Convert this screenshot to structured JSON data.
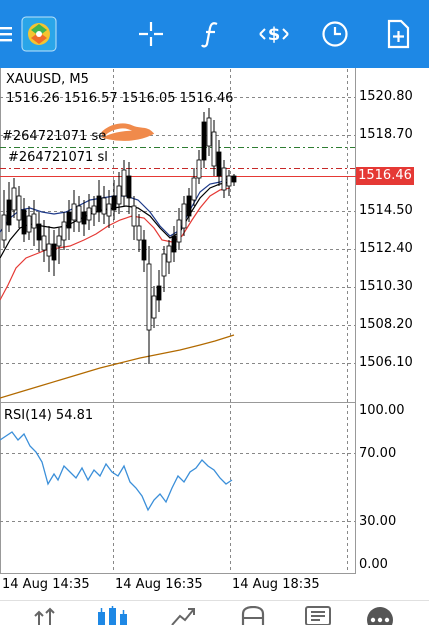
{
  "app": {
    "menu_icon": "hamburger-menu-icon",
    "logo_icon": "metatrader-logo-icon"
  },
  "toolbar": {
    "buttons": [
      {
        "name": "crosshair",
        "icon": "crosshair-icon"
      },
      {
        "name": "indicators",
        "icon": "function-f-icon"
      },
      {
        "name": "symbols",
        "icon": "dollar-arrows-icon"
      },
      {
        "name": "timeframe",
        "icon": "clock-icon"
      },
      {
        "name": "new-order",
        "icon": "document-plus-icon"
      }
    ]
  },
  "chart": {
    "symbol_label": "XAUUSD, M5",
    "ohlc_label": "1516.26 1516.57 1516.05 1516.46",
    "order_line_1": "#264721071 se",
    "order_line_2": "#264721071 sl",
    "price_axis": [
      "1520.80",
      "1518.70",
      "1516.46",
      "1514.50",
      "1512.40",
      "1510.30",
      "1508.20",
      "1506.10"
    ],
    "current_price": "1516.46",
    "rsi_label": "RSI(14) 54.81",
    "rsi_axis": [
      "100.00",
      "70.00",
      "30.00",
      "0.00"
    ],
    "time_axis": [
      "14 Aug 14:35",
      "14 Aug 16:35",
      "14 Aug 18:35"
    ]
  },
  "colors": {
    "topbar": "#1e88e5",
    "bullish_candle": "#ffffff",
    "bearish_candle": "#000000",
    "ma_red": "#e53935",
    "ma_blue": "#1e3a8a",
    "ma_black": "#000000",
    "ma_orange": "#b26a00",
    "rsi_line": "#3b8fd9",
    "current_price_bg": "#e53935",
    "order_line_green": "#2e7d32",
    "annotation_scribble": "#f08a4b"
  },
  "bottom_nav": {
    "items": [
      {
        "name": "quotes",
        "icon": "arrows-up-down-icon"
      },
      {
        "name": "chart",
        "icon": "candlestick-icon",
        "active": true
      },
      {
        "name": "trade",
        "icon": "trend-line-icon"
      },
      {
        "name": "history",
        "icon": "history-icon"
      },
      {
        "name": "messages",
        "icon": "news-icon"
      },
      {
        "name": "more",
        "icon": "more-dots-icon"
      }
    ]
  }
}
